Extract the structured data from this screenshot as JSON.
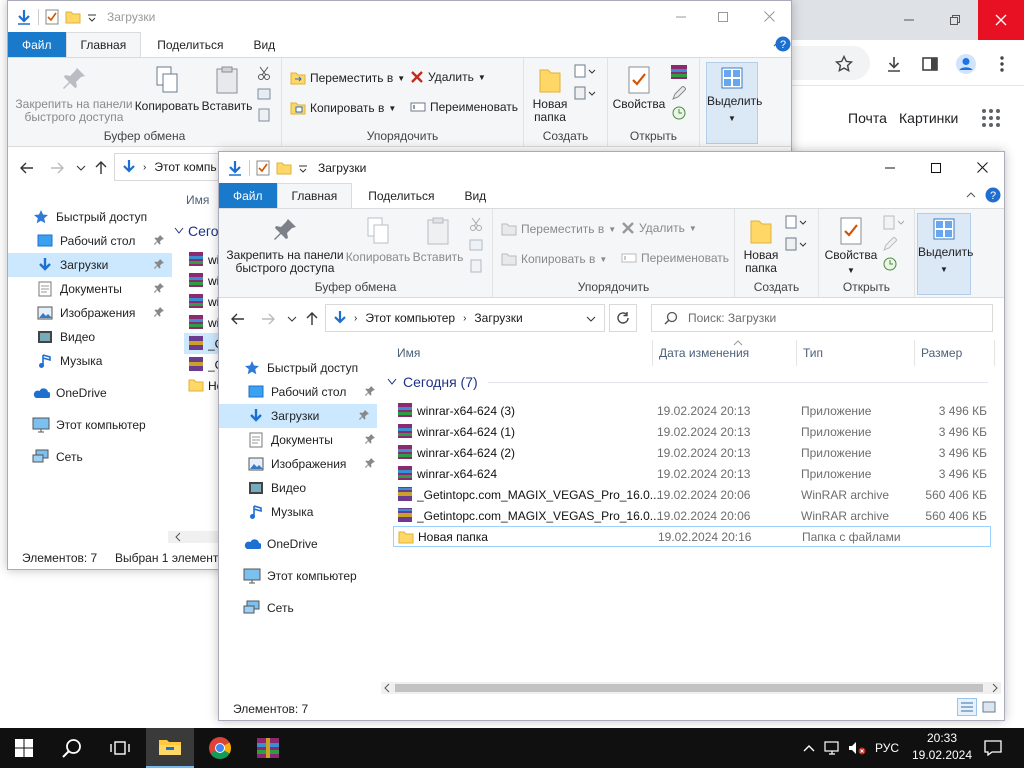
{
  "chrome": {
    "links": {
      "mail": "Почта",
      "images": "Картинки"
    }
  },
  "back_window": {
    "title": "Загрузки",
    "tabs": {
      "file": "Файл",
      "home": "Главная",
      "share": "Поделиться",
      "view": "Вид"
    },
    "ribbon": {
      "pin": "Закрепить на панели быстрого доступа",
      "copy": "Копировать",
      "paste": "Вставить",
      "clipboard_group": "Буфер обмена",
      "move_to": "Переместить в",
      "copy_to": "Копировать в",
      "delete": "Удалить",
      "rename": "Переименовать",
      "organize_group": "Упорядочить",
      "new_folder": "Новая папка",
      "create_group": "Создать",
      "properties": "Свойства",
      "open_group": "Открыть",
      "select": "Выделить"
    },
    "address_text": "Этот компь",
    "nav": [
      "Быстрый доступ",
      "Рабочий стол",
      "Загрузки",
      "Документы",
      "Изображения",
      "Видео",
      "Музыка",
      "OneDrive",
      "Этот компьютер",
      "Сеть"
    ],
    "col_name": "Имя",
    "group": "Сегод",
    "rows": [
      "wi",
      "wi",
      "wi",
      "wi",
      "_G",
      "_G",
      "Но"
    ],
    "status_count": "Элементов: 7",
    "status_selected": "Выбран 1 элемент"
  },
  "front_window": {
    "title": "Загрузки",
    "tabs": {
      "file": "Файл",
      "home": "Главная",
      "share": "Поделиться",
      "view": "Вид"
    },
    "ribbon": {
      "pin": "Закрепить на панели быстрого доступа",
      "copy": "Копировать",
      "paste": "Вставить",
      "clipboard_group": "Буфер обмена",
      "move_to": "Переместить в",
      "copy_to": "Копировать в",
      "delete": "Удалить",
      "rename": "Переименовать",
      "organize_group": "Упорядочить",
      "new_folder": "Новая папка",
      "create_group": "Создать",
      "properties": "Свойства",
      "open_group": "Открыть",
      "select": "Выделить"
    },
    "breadcrumb": [
      "Этот компьютер",
      "Загрузки"
    ],
    "search_placeholder": "Поиск: Загрузки",
    "nav": [
      "Быстрый доступ",
      "Рабочий стол",
      "Загрузки",
      "Документы",
      "Изображения",
      "Видео",
      "Музыка",
      "OneDrive",
      "Этот компьютер",
      "Сеть"
    ],
    "columns": {
      "name": "Имя",
      "date": "Дата изменения",
      "type": "Тип",
      "size": "Размер"
    },
    "group": "Сегодня (7)",
    "files": [
      {
        "name": "winrar-x64-624 (3)",
        "date": "19.02.2024 20:13",
        "type": "Приложение",
        "size": "3 496 КБ"
      },
      {
        "name": "winrar-x64-624 (1)",
        "date": "19.02.2024 20:13",
        "type": "Приложение",
        "size": "3 496 КБ"
      },
      {
        "name": "winrar-x64-624 (2)",
        "date": "19.02.2024 20:13",
        "type": "Приложение",
        "size": "3 496 КБ"
      },
      {
        "name": "winrar-x64-624",
        "date": "19.02.2024 20:13",
        "type": "Приложение",
        "size": "3 496 КБ"
      },
      {
        "name": "_Getintopc.com_MAGIX_VEGAS_Pro_16.0...",
        "date": "19.02.2024 20:06",
        "type": "WinRAR archive",
        "size": "560 406 КБ"
      },
      {
        "name": "_Getintopc.com_MAGIX_VEGAS_Pro_16.0...",
        "date": "19.02.2024 20:06",
        "type": "WinRAR archive",
        "size": "560 406 КБ"
      },
      {
        "name": "Новая папка",
        "date": "19.02.2024 20:16",
        "type": "Папка с файлами",
        "size": ""
      }
    ],
    "status_count": "Элементов: 7"
  },
  "taskbar": {
    "language": "РУС",
    "time": "20:33",
    "date": "19.02.2024"
  },
  "colors": {
    "accent": "#1979ca",
    "selection": "#cce8ff",
    "taskbar": "#101010",
    "chrome_close": "#e81123"
  }
}
